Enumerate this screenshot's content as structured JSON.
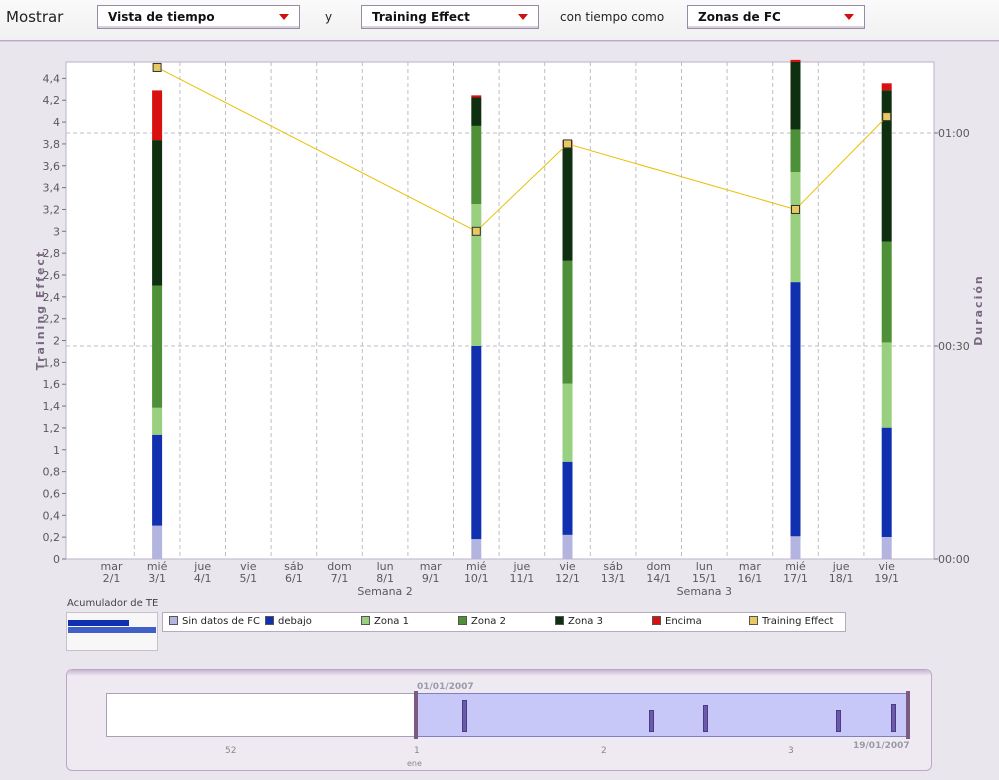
{
  "toolbar": {
    "show_label": "Mostrar",
    "dropdown1": "Vista de tiempo",
    "y_label": "y",
    "dropdown2": "Training Effect",
    "time_label": "con tiempo como",
    "dropdown3": "Zonas de FC"
  },
  "colors": {
    "no_hr": "#b4b4e0",
    "below": "#1030b0",
    "zone1": "#98d080",
    "zone2": "#4e9038",
    "zone3": "#0f3010",
    "above": "#d81010",
    "te_line": "#e8c000",
    "te_marker": "#e8c860"
  },
  "chart_data": {
    "type": "bar",
    "y_left_label": "Training Effect",
    "y_right_label": "Duración",
    "y_left_ticks": [
      "0",
      "0,2",
      "0,4",
      "0,6",
      "0,8",
      "1",
      "1,2",
      "1,4",
      "1,6",
      "1,8",
      "2",
      "2,2",
      "2,4",
      "2,6",
      "2,8",
      "3",
      "3,2",
      "3,4",
      "3,6",
      "3,8",
      "4",
      "4,2",
      "4,4"
    ],
    "y_left_range": [
      0,
      4.55
    ],
    "y_right_ticks": [
      "00:00",
      "00:30",
      "01:00"
    ],
    "y_right_range_minutes": [
      0,
      70
    ],
    "days": [
      {
        "dow": "mar",
        "date": "2/1"
      },
      {
        "dow": "mié",
        "date": "3/1"
      },
      {
        "dow": "jue",
        "date": "4/1"
      },
      {
        "dow": "vie",
        "date": "5/1"
      },
      {
        "dow": "sáb",
        "date": "6/1"
      },
      {
        "dow": "dom",
        "date": "7/1"
      },
      {
        "dow": "lun",
        "date": "8/1"
      },
      {
        "dow": "mar",
        "date": "9/1"
      },
      {
        "dow": "mié",
        "date": "10/1"
      },
      {
        "dow": "jue",
        "date": "11/1"
      },
      {
        "dow": "vie",
        "date": "12/1"
      },
      {
        "dow": "sáb",
        "date": "13/1"
      },
      {
        "dow": "dom",
        "date": "14/1"
      },
      {
        "dow": "lun",
        "date": "15/1"
      },
      {
        "dow": "mar",
        "date": "16/1"
      },
      {
        "dow": "mié",
        "date": "17/1"
      },
      {
        "dow": "jue",
        "date": "18/1"
      },
      {
        "dow": "vie",
        "date": "19/1"
      }
    ],
    "weeks": [
      {
        "label": "Semana 2",
        "day_index": 6
      },
      {
        "label": "Semana 3",
        "day_index": 13
      }
    ],
    "series_names": [
      "Sin datos de FC",
      "debajo",
      "Zona 1",
      "Zona 2",
      "Zona 3",
      "Encima",
      "Training Effect"
    ],
    "workouts": [
      {
        "day_index": 1,
        "minutes_cumulative": [
          4.7,
          17.5,
          21.3,
          38.5,
          59.0,
          66.0,
          66.0
        ],
        "training_effect": 4.5
      },
      {
        "day_index": 8,
        "minutes_cumulative": [
          2.8,
          30.0,
          50.0,
          61.0,
          65.0,
          65.3,
          65.3
        ],
        "training_effect": 3.0
      },
      {
        "day_index": 10,
        "minutes_cumulative": [
          3.4,
          13.7,
          24.7,
          42.0,
          58.0,
          59.0,
          59.0
        ],
        "training_effect": 3.8
      },
      {
        "day_index": 15,
        "minutes_cumulative": [
          3.2,
          39.0,
          54.5,
          60.5,
          70.0,
          70.3,
          70.3
        ],
        "training_effect": 3.2
      },
      {
        "day_index": 17,
        "minutes_cumulative": [
          3.1,
          18.5,
          30.5,
          44.7,
          66.0,
          67.0,
          67.0
        ],
        "training_effect": 4.05
      }
    ]
  },
  "accumulator": {
    "label": "Acumulador de TE"
  },
  "navigator": {
    "start_date": "01/01/2007",
    "end_date": "19/01/2007",
    "ticks": [
      "52",
      "1",
      "2",
      "3"
    ],
    "month_label": "ene"
  }
}
